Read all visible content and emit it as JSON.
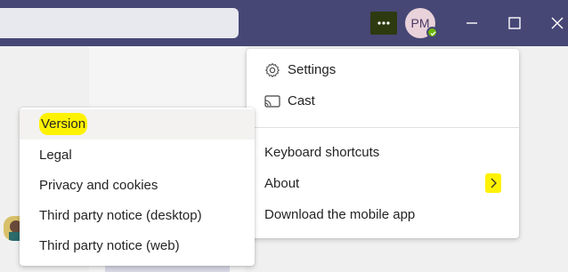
{
  "header": {
    "avatar_initials": "PM",
    "presence": "available",
    "more_icon": "ellipsis-icon",
    "window_controls": [
      "minimize-icon",
      "maximize-icon",
      "close-icon"
    ]
  },
  "menu": {
    "settings_label": "Settings",
    "cast_label": "Cast",
    "keyboard_shortcuts_label": "Keyboard shortcuts",
    "about_label": "About",
    "download_app_label": "Download the mobile app"
  },
  "about_submenu": {
    "items": [
      {
        "label": "Version"
      },
      {
        "label": "Legal"
      },
      {
        "label": "Privacy and cookies"
      },
      {
        "label": "Third party notice (desktop)"
      },
      {
        "label": "Third party notice (web)"
      }
    ]
  },
  "colors": {
    "titlebar": "#464775",
    "highlight": "#fff200",
    "presence": "#6bb700"
  }
}
